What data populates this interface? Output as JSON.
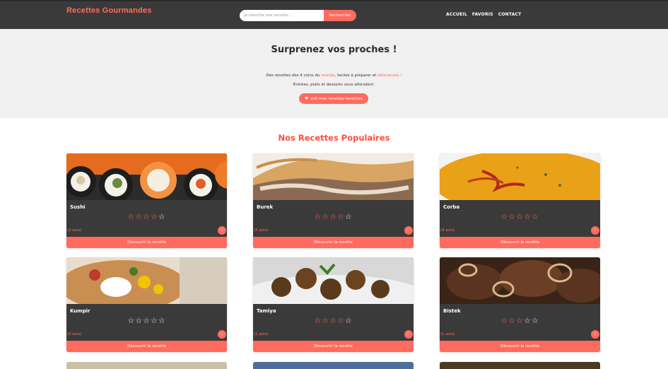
{
  "header": {
    "brand": "Recettes Gourmandes",
    "search_placeholder": "Je cherche une recette...",
    "search_button": "Rechercher",
    "nav": [
      "ACCUEIL",
      "FAVORIS",
      "CONTACT"
    ]
  },
  "hero": {
    "title": "Surprenez vos proches !",
    "line1_a": "Des recettes des 4 coins du ",
    "line1_hl1": "monde",
    "line1_b": ", faciles à préparer et ",
    "line1_hl2": "délicieuses !",
    "line2": "Entrées, plats et desserts vous attendent.",
    "fav_button": "voir mes recettes favorites"
  },
  "section_title": "Nos Recettes Populaires",
  "cta_label": "Découvrir la recette",
  "colors": {
    "accent": "#ff6b5e",
    "header_bg": "#3a3a3a",
    "hero_bg": "#f0f0f0"
  },
  "recipes": [
    {
      "name": "Sushi",
      "rating": 4,
      "reviews": "(2 avis)"
    },
    {
      "name": "Burek",
      "rating": 4,
      "reviews": "(5 avis)"
    },
    {
      "name": "Corba",
      "rating": 5,
      "reviews": "(4 avis)"
    },
    {
      "name": "Kumpir",
      "rating": 0,
      "reviews": "(0 avis)"
    },
    {
      "name": "Tamiya",
      "rating": 4,
      "reviews": "(1 avis)"
    },
    {
      "name": "Bistek",
      "rating": 3,
      "reviews": "(1 avis)"
    }
  ]
}
